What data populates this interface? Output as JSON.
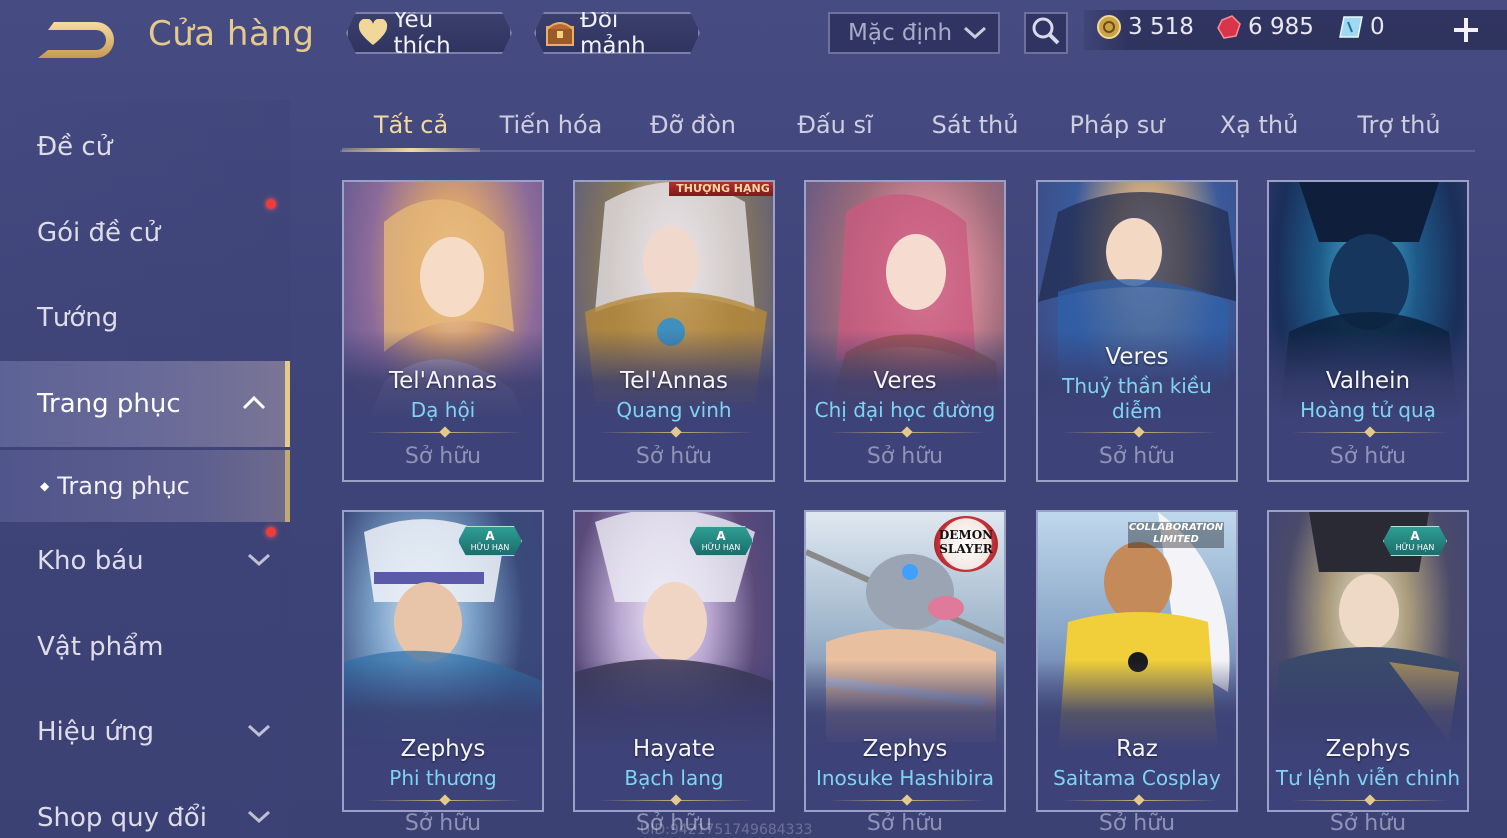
{
  "header": {
    "title": "Cửa hàng",
    "favorite_label": "Yêu thích",
    "exchange_label": "Đổi mảnh",
    "sort_value": "Mặc định"
  },
  "currency": {
    "gold": "3 518",
    "ruby": "6 985",
    "voucher": "0"
  },
  "sidebar": {
    "items": [
      {
        "label": "Đề cử"
      },
      {
        "label": "Gói đề cử"
      },
      {
        "label": "Tướng"
      },
      {
        "label": "Trang phục"
      },
      {
        "label": "Trang phục"
      },
      {
        "label": "Kho báu"
      },
      {
        "label": "Vật phẩm"
      },
      {
        "label": "Hiệu ứng"
      },
      {
        "label": "Shop quy đổi"
      }
    ]
  },
  "tabs": [
    {
      "label": "Tất cả"
    },
    {
      "label": "Tiến hóa"
    },
    {
      "label": "Đỡ đòn"
    },
    {
      "label": "Đấu sĩ"
    },
    {
      "label": "Sát thủ"
    },
    {
      "label": "Pháp sư"
    },
    {
      "label": "Xạ thủ"
    },
    {
      "label": "Trợ thủ"
    }
  ],
  "cards": [
    {
      "hero": "Tel'Annas",
      "skin": "Dạ hội",
      "status": "Sở hữu"
    },
    {
      "hero": "Tel'Annas",
      "skin": "Quang vinh",
      "status": "Sở hữu",
      "tag": "THƯỢNG HẠNG"
    },
    {
      "hero": "Veres",
      "skin": "Chị đại học đường",
      "status": "Sở hữu"
    },
    {
      "hero": "Veres",
      "skin": "Thuỷ thần kiều diễm",
      "status": "Sở hữu"
    },
    {
      "hero": "Valhein",
      "skin": "Hoàng tử quạ",
      "status": "Sở hữu"
    },
    {
      "hero": "Zephys",
      "skin": "Phi thương",
      "status": "Sở hữu",
      "badge_grade": "A",
      "badge_text": "HỮU HẠN"
    },
    {
      "hero": "Hayate",
      "skin": "Bạch lang",
      "status": "Sở hữu",
      "badge_grade": "A",
      "badge_text": "HỮU HẠN"
    },
    {
      "hero": "Zephys",
      "skin": "Inosuke Hashibira",
      "status": "Sở hữu",
      "logo_line1": "DEMON",
      "logo_line2": "SLAYER"
    },
    {
      "hero": "Raz",
      "skin": "Saitama Cosplay",
      "status": "Sở hữu",
      "collab_line1": "COLLABORATION",
      "collab_line2": "LIMITED"
    },
    {
      "hero": "Zephys",
      "skin": "Tư lệnh viễn chinh",
      "status": "Sở hữu",
      "badge_grade": "A",
      "badge_text": "HỮU HẠN"
    }
  ],
  "watermark": "UID:9421751749684333",
  "colors": {
    "accent_gold": "#e6c98c",
    "skin_name_blue": "#7fd4f4",
    "notification_red": "#f03b3b",
    "background": "#3f4579"
  }
}
